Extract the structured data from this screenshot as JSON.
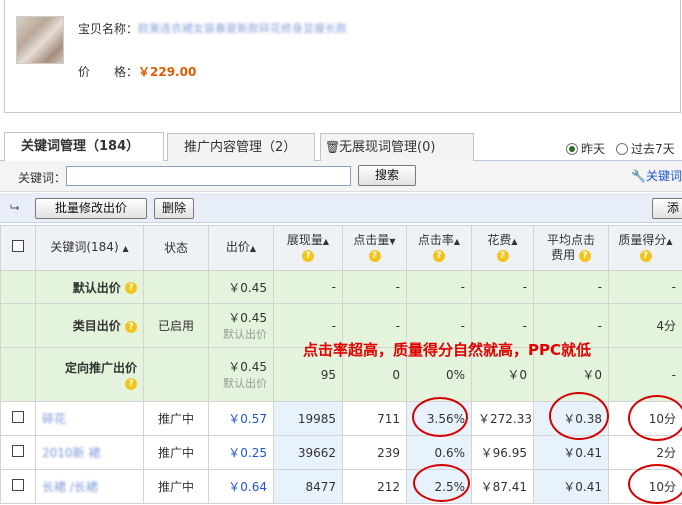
{
  "product": {
    "name_label": "宝贝名称：",
    "name_value": "欧美连衣裙女装春夏新款碎花修身显瘦长款",
    "price_label": "价　　格：",
    "price_value": "￥229.00"
  },
  "tabs": [
    {
      "label": "关键词管理（184）"
    },
    {
      "label": "推广内容管理（2）"
    },
    {
      "label": "无展现词管理(0)"
    }
  ],
  "date_filter": {
    "yesterday": "昨天",
    "last7": "过去7天",
    "selected": "yesterday"
  },
  "search": {
    "label": "关键词：",
    "value": "",
    "button": "搜索",
    "tool_link": "关键词"
  },
  "actions": {
    "batch_bid": "批量修改出价",
    "delete": "删除",
    "add": "添"
  },
  "table": {
    "headers": {
      "keyword": "关键词(184)",
      "status": "状态",
      "bid": "出价",
      "impressions": "展现量",
      "clicks": "点击量",
      "ctr": "点击率",
      "cost": "花费",
      "avg_cpc_1": "平均点击",
      "avg_cpc_2": "费用",
      "quality": "质量得分"
    },
    "default_rows": [
      {
        "name": "默认出价",
        "status": "",
        "bid": "￥0.45",
        "bid_note": "",
        "impressions": "-",
        "clicks": "-",
        "ctr": "-",
        "cost": "-",
        "cpc": "-",
        "quality": "-"
      },
      {
        "name": "类目出价",
        "status": "已启用",
        "bid": "￥0.45",
        "bid_note": "默认出价",
        "impressions": "-",
        "clicks": "-",
        "ctr": "-",
        "cost": "-",
        "cpc": "-",
        "quality": "4分"
      },
      {
        "name": "定向推广出价",
        "status": "",
        "bid": "￥0.45",
        "bid_note": "默认出价",
        "impressions": "95",
        "clicks": "0",
        "ctr": "0%",
        "cost": "￥0",
        "cpc": "￥0",
        "quality": "-"
      }
    ],
    "keyword_rows": [
      {
        "keyword": "碎花",
        "status": "推广中",
        "bid": "￥0.57",
        "impressions": "19985",
        "clicks": "711",
        "ctr": "3.56%",
        "cost": "￥272.33",
        "cpc": "￥0.38",
        "quality": "10分"
      },
      {
        "keyword": "2010新 裙",
        "status": "推广中",
        "bid": "￥0.25",
        "impressions": "39662",
        "clicks": "239",
        "ctr": "0.6%",
        "cost": "￥96.95",
        "cpc": "￥0.41",
        "quality": "2分"
      },
      {
        "keyword": "长裙 /长裙",
        "status": "推广中",
        "bid": "￥0.64",
        "impressions": "8477",
        "clicks": "212",
        "ctr": "2.5%",
        "cost": "￥87.41",
        "cpc": "￥0.41",
        "quality": "10分"
      }
    ]
  },
  "annotation": "点击率超高，质量得分自然就高，PPC就低",
  "colors": {
    "price": "#e05a00",
    "link": "#2255cc",
    "annotation": "#e00000",
    "default_rows_bg": "#e3f3dc"
  }
}
